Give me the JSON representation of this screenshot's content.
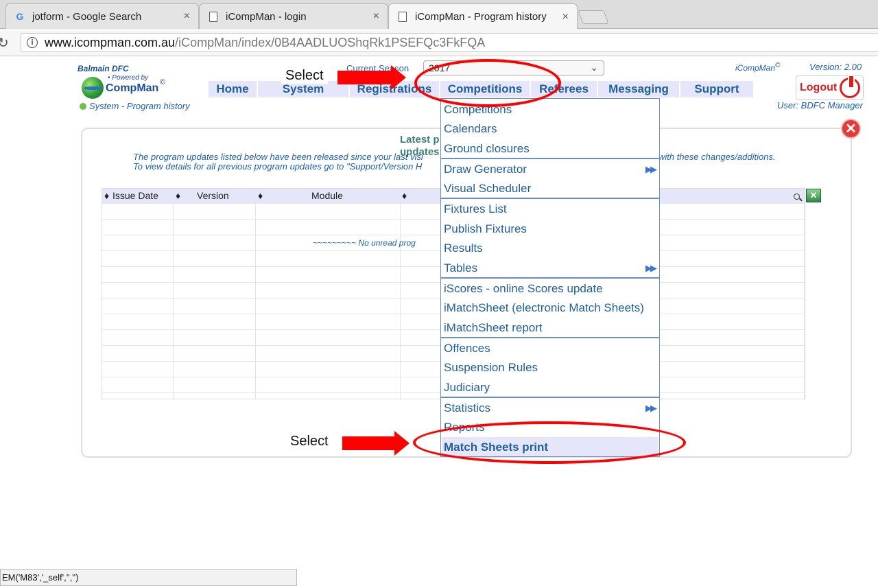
{
  "browser": {
    "tabs": [
      {
        "title": "jotform - Google Search",
        "icon": "google-icon"
      },
      {
        "title": "iCompMan - login",
        "icon": "document-icon"
      },
      {
        "title": "iCompMan - Program history",
        "icon": "document-icon",
        "active": true
      }
    ],
    "url_host": "www.icompman.com.au",
    "url_path": "/iCompMan/index/0B4AADLUOShqRk1PSEFQc3FkFQA"
  },
  "header": {
    "club": "Balmain DFC",
    "powered_by": "Powered by",
    "logo_text": "CompMan",
    "logo_copy": "©",
    "breadcrumb": "System - Program history",
    "season_label": "Current Season",
    "season_value": "2017",
    "brand": "iCompMan",
    "brand_copy": "©",
    "version": "Version: 2.00",
    "logout_label": "Logout",
    "user": "User: BDFC Manager"
  },
  "nav": {
    "home": "Home",
    "system": "System",
    "registrations": "Registrations",
    "competitions": "Competitions",
    "referees": "Referees",
    "messaging": "Messaging",
    "support": "Support"
  },
  "content": {
    "latest_line1": "Latest p",
    "latest_line2": "updates",
    "notice_left1": "The program updates listed below have been released since your last visi",
    "notice_right1": "with these changes/additions.",
    "notice_left2": "To view details for all previous program updates go to \"Support/Version H",
    "columns": [
      "Issue Date",
      "Version",
      "Module"
    ],
    "no_data": "~~~~~~~~~ No unread prog",
    "sort_glyph": "♦"
  },
  "menu": {
    "items": [
      "Competitions",
      "Calendars",
      "Ground closures",
      "Draw Generator",
      "Visual Scheduler",
      "Fixtures List",
      "Publish Fixtures",
      "Results",
      "Tables",
      "iScores - online Scores update",
      "iMatchSheet (electronic Match Sheets)",
      "iMatchSheet report",
      "Offences",
      "Suspension Rules",
      "Judiciary",
      "Statistics",
      "Reports",
      "Match Sheets print"
    ],
    "submenu_glyph": "▶▶"
  },
  "annotations": {
    "top_label": "Select",
    "bottom_label": "Select",
    "color": "#ff0000"
  },
  "status_bar": "EM('M83','_self','','')"
}
